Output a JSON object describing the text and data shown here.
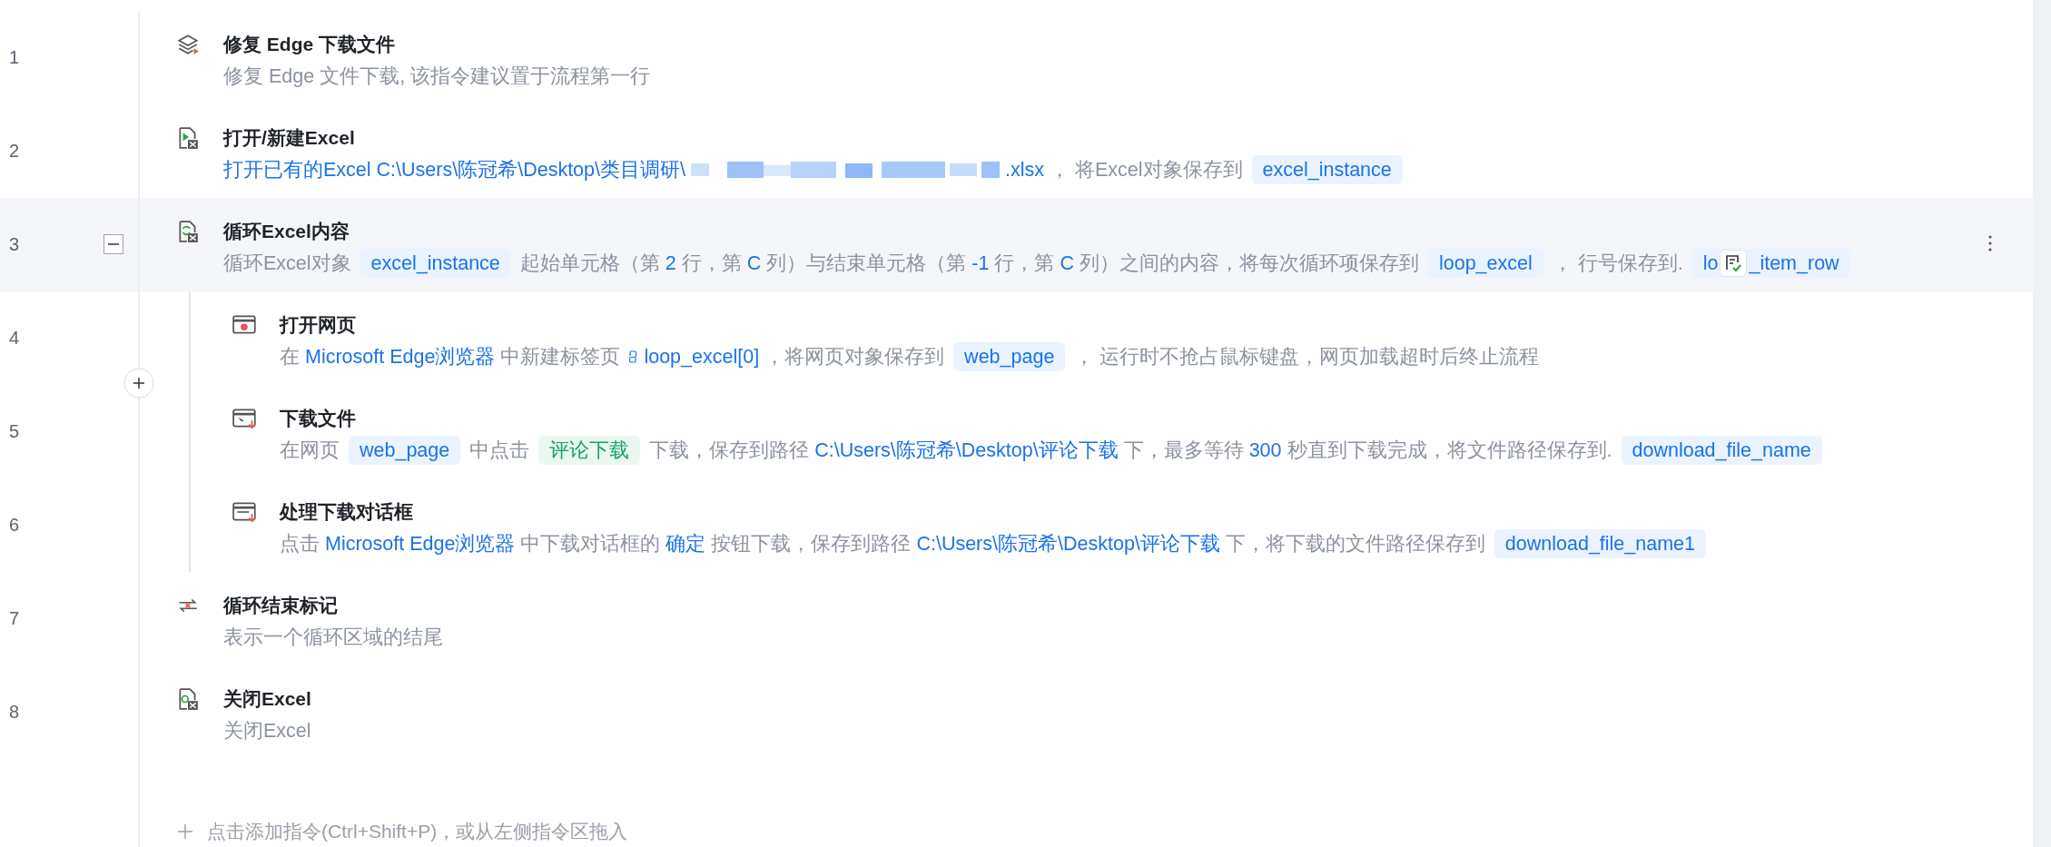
{
  "steps": [
    {
      "number": "1",
      "kind": "repair",
      "title": "修复 Edge 下载文件",
      "selected": false,
      "desc": [
        {
          "kind": "text",
          "text": "修复 Edge 文件下载, 该指令建议置于流程第一行"
        }
      ]
    },
    {
      "number": "2",
      "kind": "open_excel",
      "title": "打开/新建Excel",
      "selected": false,
      "desc": [
        {
          "kind": "link",
          "text": "打开已有的Excel"
        },
        {
          "kind": "link",
          "text": "C:\\Users\\陈冠希\\Desktop\\类目调研\\"
        },
        {
          "kind": "redacted"
        },
        {
          "kind": "link",
          "text": ".xlsx"
        },
        {
          "kind": "text",
          "text": "， 将Excel对象保存到"
        },
        {
          "kind": "var",
          "text": "excel_instance"
        }
      ]
    },
    {
      "number": "3",
      "kind": "loop_excel",
      "title": "循环Excel内容",
      "selected": true,
      "expanded": true,
      "desc": [
        {
          "kind": "text",
          "text": "循环Excel对象"
        },
        {
          "kind": "var",
          "text": "excel_instance"
        },
        {
          "kind": "text",
          "text": "起始单元格（第"
        },
        {
          "kind": "link",
          "text": "2"
        },
        {
          "kind": "text",
          "text": "行，第"
        },
        {
          "kind": "link",
          "text": "C"
        },
        {
          "kind": "text",
          "text": "列）与结束单元格（第"
        },
        {
          "kind": "link",
          "text": "-1"
        },
        {
          "kind": "text",
          "text": "行，第"
        },
        {
          "kind": "link",
          "text": "C"
        },
        {
          "kind": "text",
          "text": "列）之间的内容，将每次循环项保存到"
        },
        {
          "kind": "var",
          "text": "loop_excel"
        },
        {
          "kind": "text",
          "text": "， 行号保存到."
        },
        {
          "kind": "var_covered",
          "before": "lo",
          "after": "_item_row"
        }
      ],
      "children": [
        {
          "number": "4",
          "kind": "open_page",
          "title": "打开网页",
          "desc": [
            {
              "kind": "text",
              "text": "在"
            },
            {
              "kind": "link",
              "text": "Microsoft Edge浏览器"
            },
            {
              "kind": "text",
              "text": "中新建标签页"
            },
            {
              "kind": "py",
              "text": "loop_excel[0]"
            },
            {
              "kind": "text",
              "text": "，将网页对象保存到"
            },
            {
              "kind": "var",
              "text": "web_page"
            },
            {
              "kind": "text",
              "text": "， 运行时不抢占鼠标键盘，网页加载超时后终止流程"
            }
          ]
        },
        {
          "number": "5",
          "kind": "download",
          "title": "下载文件",
          "desc": [
            {
              "kind": "text",
              "text": "在网页"
            },
            {
              "kind": "var",
              "text": "web_page"
            },
            {
              "kind": "text",
              "text": "中点击"
            },
            {
              "kind": "tag",
              "text": "评论下载"
            },
            {
              "kind": "text",
              "text": "下载，保存到路径"
            },
            {
              "kind": "link",
              "text": "C:\\Users\\陈冠希\\Desktop\\评论下载"
            },
            {
              "kind": "text",
              "text": "下，最多等待"
            },
            {
              "kind": "link",
              "text": "300"
            },
            {
              "kind": "text",
              "text": "秒直到下载完成，将文件路径保存到."
            },
            {
              "kind": "var",
              "text": "download_file_name"
            }
          ]
        },
        {
          "number": "6",
          "kind": "dialog",
          "title": "处理下载对话框",
          "desc": [
            {
              "kind": "text",
              "text": "点击"
            },
            {
              "kind": "link",
              "text": "Microsoft Edge浏览器"
            },
            {
              "kind": "text",
              "text": "中下载对话框的"
            },
            {
              "kind": "link",
              "text": "确定"
            },
            {
              "kind": "text",
              "text": "按钮下载，保存到路径"
            },
            {
              "kind": "link",
              "text": "C:\\Users\\陈冠希\\Desktop\\评论下载"
            },
            {
              "kind": "text",
              "text": "下，将下载的文件路径保存到"
            },
            {
              "kind": "var",
              "text": "download_file_name1"
            }
          ]
        }
      ]
    },
    {
      "number": "7",
      "kind": "loop_end",
      "title": "循环结束标记",
      "selected": false,
      "desc": [
        {
          "kind": "text",
          "text": "表示一个循环区域的结尾"
        }
      ]
    },
    {
      "number": "8",
      "kind": "close_excel",
      "title": "关闭Excel",
      "selected": false,
      "desc": [
        {
          "kind": "text",
          "text": "关闭Excel"
        }
      ]
    }
  ],
  "add_hint": "点击添加指令(Ctrl+Shift+P)，或从左侧指令区拖入"
}
